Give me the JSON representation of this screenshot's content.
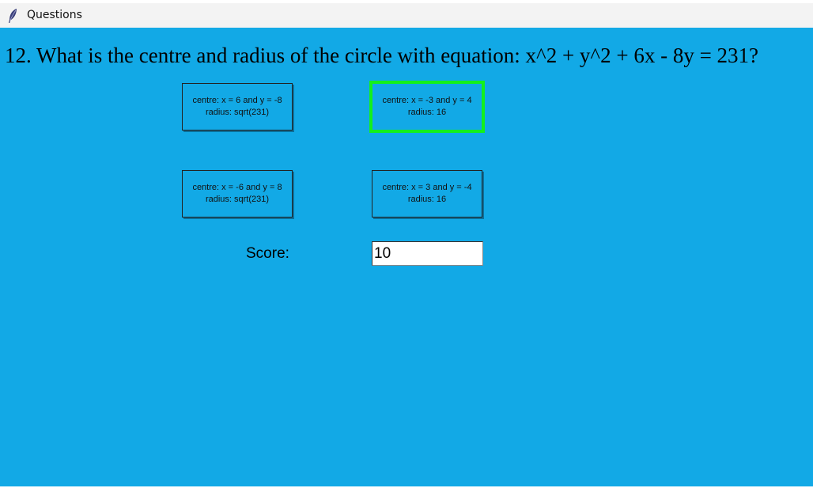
{
  "window": {
    "title": "Questions",
    "icon": "feather-icon"
  },
  "question": {
    "text": "12. What is the centre and radius of the circle with equation: x^2 + y^2 + 6x - 8y = 231?"
  },
  "answers": [
    {
      "line1": "centre: x = 6 and y = -8",
      "line2": "radius: sqrt(231)",
      "selected": false
    },
    {
      "line1": "centre: x = -3 and y = 4",
      "line2": "radius: 16",
      "selected": true
    },
    {
      "line1": "centre: x = -6 and y = 8",
      "line2": "radius: sqrt(231)",
      "selected": false
    },
    {
      "line1": "centre: x = 3 and y = -4",
      "line2": "radius: 16",
      "selected": false
    }
  ],
  "score": {
    "label": "Score:",
    "value": "10"
  },
  "colors": {
    "background": "#12a9e6",
    "selected_border": "#13f01c",
    "titlebar": "#f3f3f3"
  }
}
